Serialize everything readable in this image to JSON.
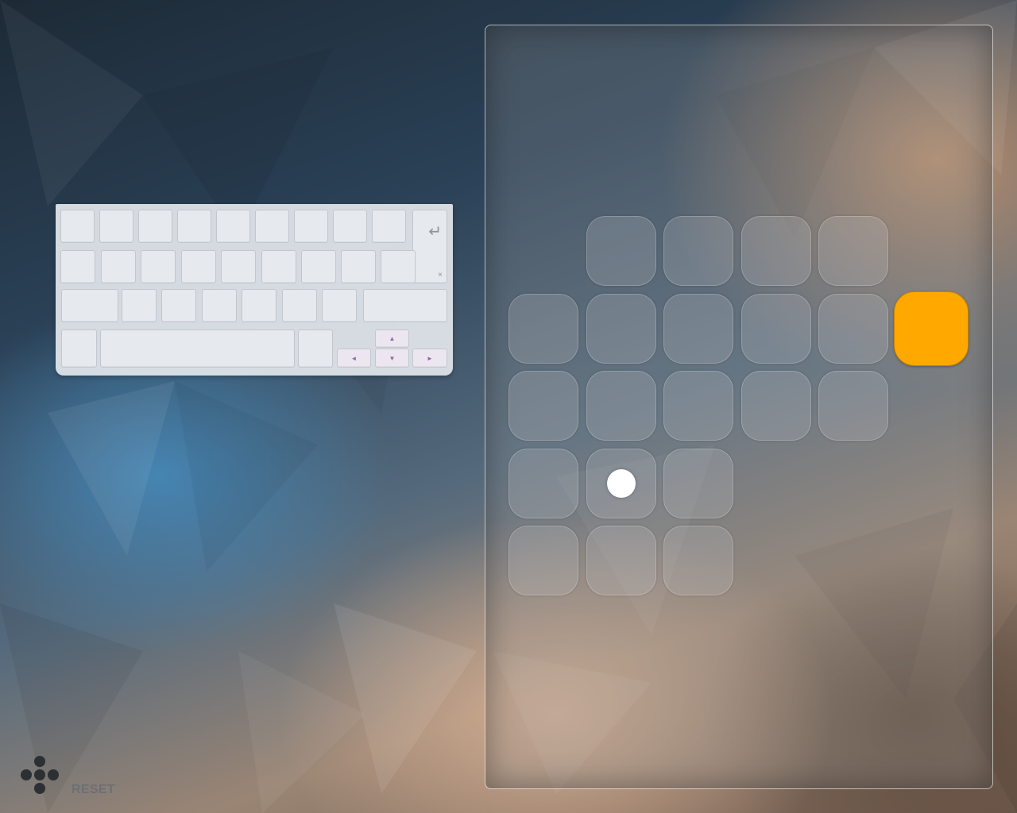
{
  "reset": {
    "label": "RESET"
  },
  "icons": {
    "enter": "enter-arrow-icon",
    "delete": "delete-x-icon",
    "arrow_up": "arrow-up-icon",
    "arrow_down": "arrow-down-icon",
    "arrow_left": "arrow-left-icon",
    "arrow_right": "arrow-right-icon",
    "menu": "dots-menu-icon"
  },
  "keyboard_glyphs": {
    "enter": "↵",
    "delete": "×",
    "up": "▲",
    "down": "▼",
    "left": "◄",
    "right": "►"
  },
  "colors": {
    "goal": "#ffa800",
    "ball": "#ffffff",
    "arrow_key": "#9a63a8"
  },
  "board": {
    "rows": [
      [
        0,
        1,
        1,
        1,
        1,
        0
      ],
      [
        1,
        1,
        1,
        1,
        1,
        2
      ],
      [
        1,
        1,
        1,
        1,
        1,
        0
      ],
      [
        1,
        1,
        1,
        0,
        0,
        0
      ],
      [
        1,
        1,
        1,
        0,
        0,
        0
      ]
    ],
    "legend": {
      "0": "empty",
      "1": "tile",
      "2": "goal"
    },
    "ball": {
      "row": 3,
      "col": 1
    }
  }
}
